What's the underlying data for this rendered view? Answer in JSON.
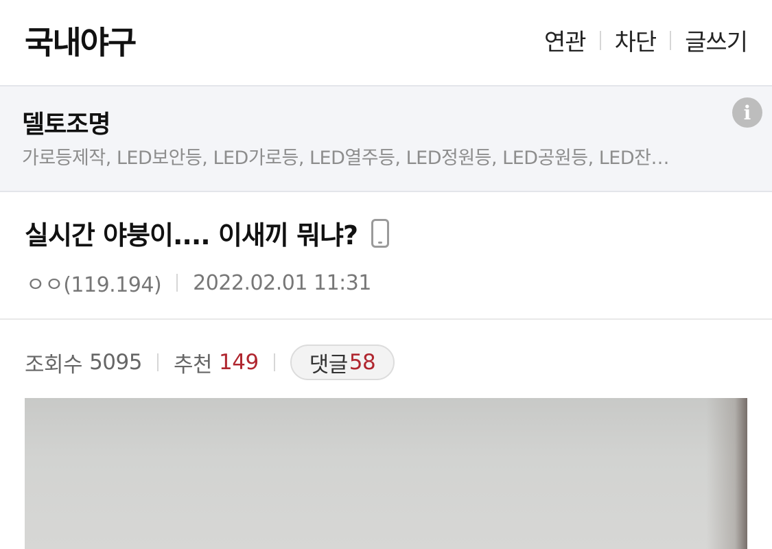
{
  "header": {
    "title": "국내야구",
    "actions": [
      "연관",
      "차단",
      "글쓰기"
    ]
  },
  "ad": {
    "title": "델토조명",
    "description": "가로등제작, LED보안등, LED가로등, LED열주등, LED정원등, LED공원등, LED잔…",
    "icon": "info-icon"
  },
  "post": {
    "title": "실시간 야붕이.... 이새끼 뭐냐?",
    "device_icon": "mobile-phone-icon",
    "author": "ㅇㅇ(119.194)",
    "datetime": "2022.02.01 11:31"
  },
  "stats": {
    "views_label": "조회수",
    "views": "5095",
    "recommend_label": "추천",
    "recommend": "149",
    "comments_label": "댓글",
    "comments": "58"
  },
  "colors": {
    "accent_red": "#b0262f",
    "ad_bg": "#f4f5f8"
  }
}
